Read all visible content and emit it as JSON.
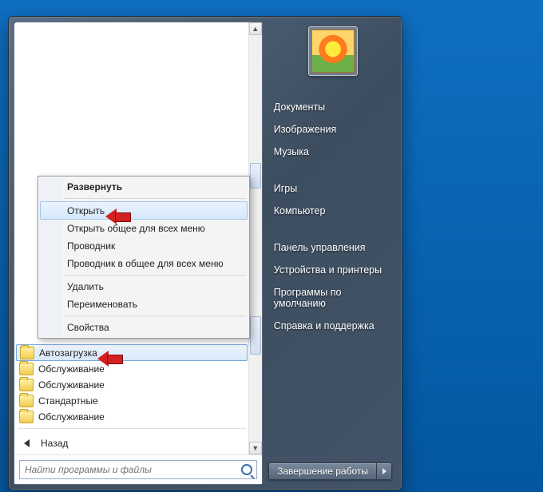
{
  "context_menu": {
    "header": "Развернуть",
    "items_top": [
      "Открыть",
      "Открыть общее для всех меню",
      "Проводник",
      "Проводник в общее для всех меню"
    ],
    "items_mid": [
      "Удалить",
      "Переименовать"
    ],
    "items_bot": [
      "Свойства"
    ],
    "highlighted": "Открыть"
  },
  "left": {
    "folders": [
      "Автозагрузка",
      "Обслуживание",
      "Обслуживание",
      "Стандартные",
      "Обслуживание"
    ],
    "selected": "Автозагрузка",
    "back": "Назад",
    "search_placeholder": "Найти программы и файлы"
  },
  "right": {
    "group1": [
      "Документы",
      "Изображения",
      "Музыка"
    ],
    "group2": [
      "Игры",
      "Компьютер"
    ],
    "group3": [
      "Панель управления",
      "Устройства и принтеры",
      "Программы по умолчанию",
      "Справка и поддержка"
    ],
    "shutdown": "Завершение работы"
  }
}
